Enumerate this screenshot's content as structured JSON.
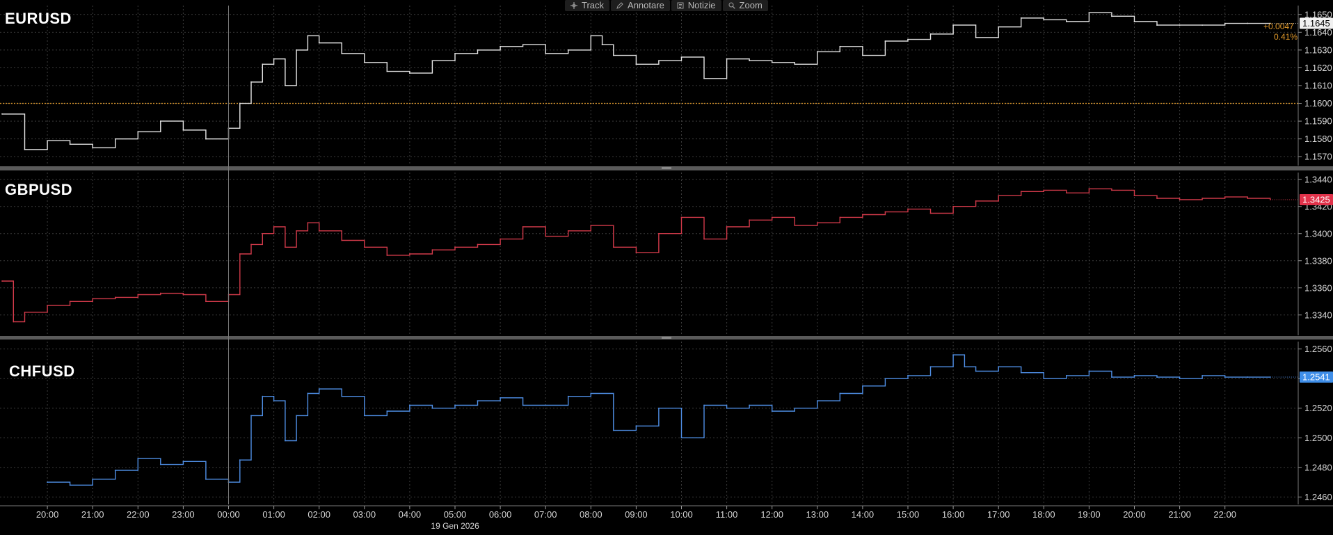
{
  "toolbar": {
    "items": [
      {
        "label": "Track",
        "icon": "crosshair-icon"
      },
      {
        "label": "Annotare",
        "icon": "pencil-icon"
      },
      {
        "label": "Notizie",
        "icon": "news-icon"
      },
      {
        "label": "Zoom",
        "icon": "magnifier-icon"
      }
    ]
  },
  "x_axis": {
    "ticks": [
      "20:00",
      "21:00",
      "22:00",
      "23:00",
      "00:00",
      "01:00",
      "02:00",
      "03:00",
      "04:00",
      "05:00",
      "06:00",
      "07:00",
      "08:00",
      "09:00",
      "10:00",
      "11:00",
      "12:00",
      "13:00",
      "14:00",
      "15:00",
      "16:00",
      "17:00",
      "18:00",
      "19:00",
      "20:00",
      "21:00",
      "22:00"
    ],
    "date_label": "19 Gen 2026"
  },
  "colors": {
    "background": "#000000",
    "grid": "#3c3c3c",
    "eur_line": "#e6e6e6",
    "gbp_line": "#d23a4a",
    "chf_line": "#4f8fe6",
    "reference_line": "#e39b2c",
    "divider": "#5a5a5a"
  },
  "chart_data": [
    {
      "type": "line",
      "title": "EURUSD",
      "last_value": "1.1645",
      "change_abs": "+0.0047",
      "change_pct": "0.41%",
      "reference_level": 1.16,
      "ylim": [
        1.1565,
        1.1655
      ],
      "yticks": [
        "1.1570",
        "1.1580",
        "1.1590",
        "1.1600",
        "1.1610",
        "1.1620",
        "1.1630",
        "1.1640",
        "1.1650"
      ],
      "series": [
        {
          "x": [
            "19:00",
            "19:30",
            "20:00",
            "20:30",
            "21:00",
            "21:30",
            "22:00",
            "22:30",
            "23:00",
            "23:30",
            "00:00",
            "00:15",
            "00:30",
            "00:45",
            "01:00",
            "01:15",
            "01:30",
            "01:45",
            "02:00",
            "02:30",
            "03:00",
            "03:30",
            "04:00",
            "04:30",
            "05:00",
            "05:30",
            "06:00",
            "06:30",
            "07:00",
            "07:30",
            "08:00",
            "08:15",
            "08:30",
            "09:00",
            "09:30",
            "10:00",
            "10:30",
            "11:00",
            "11:30",
            "12:00",
            "12:30",
            "13:00",
            "13:30",
            "14:00",
            "14:30",
            "15:00",
            "15:30",
            "16:00",
            "16:30",
            "17:00",
            "17:30",
            "18:00",
            "18:30",
            "19:00",
            "19:30",
            "20:00",
            "20:30",
            "21:00",
            "21:30",
            "22:00",
            "22:30",
            "23:00"
          ],
          "values": [
            1.1594,
            1.1574,
            1.1579,
            1.1577,
            1.1575,
            1.158,
            1.1584,
            1.159,
            1.1585,
            1.158,
            1.1586,
            1.16,
            1.1612,
            1.1622,
            1.1625,
            1.161,
            1.163,
            1.1638,
            1.1634,
            1.1628,
            1.1623,
            1.1618,
            1.1617,
            1.1624,
            1.1628,
            1.163,
            1.1632,
            1.1633,
            1.1628,
            1.163,
            1.1638,
            1.1633,
            1.1627,
            1.1622,
            1.1624,
            1.1626,
            1.1614,
            1.1625,
            1.1624,
            1.1623,
            1.1622,
            1.1629,
            1.1632,
            1.1627,
            1.1635,
            1.1636,
            1.1639,
            1.1644,
            1.1637,
            1.1643,
            1.1648,
            1.1647,
            1.1646,
            1.1651,
            1.1649,
            1.1646,
            1.1644,
            1.1644,
            1.1644,
            1.1645,
            1.1645,
            1.1645
          ]
        }
      ]
    },
    {
      "type": "line",
      "title": "GBPUSD",
      "last_value": "1.3425",
      "ylim": [
        1.3325,
        1.3445
      ],
      "yticks": [
        "1.3340",
        "1.3360",
        "1.3380",
        "1.3400",
        "1.3420",
        "1.3440"
      ],
      "series": [
        {
          "x": [
            "19:00",
            "19:15",
            "19:30",
            "20:00",
            "20:30",
            "21:00",
            "21:30",
            "22:00",
            "22:30",
            "23:00",
            "23:30",
            "00:00",
            "00:15",
            "00:30",
            "00:45",
            "01:00",
            "01:15",
            "01:30",
            "01:45",
            "02:00",
            "02:30",
            "03:00",
            "03:30",
            "04:00",
            "04:30",
            "05:00",
            "05:30",
            "06:00",
            "06:30",
            "07:00",
            "07:30",
            "08:00",
            "08:30",
            "09:00",
            "09:30",
            "10:00",
            "10:30",
            "11:00",
            "11:30",
            "12:00",
            "12:30",
            "13:00",
            "13:30",
            "14:00",
            "14:30",
            "15:00",
            "15:30",
            "16:00",
            "16:30",
            "17:00",
            "17:30",
            "18:00",
            "18:30",
            "19:00",
            "19:30",
            "20:00",
            "20:30",
            "21:00",
            "21:30",
            "22:00",
            "22:30",
            "23:00"
          ],
          "values": [
            1.3365,
            1.3335,
            1.3342,
            1.3347,
            1.335,
            1.3352,
            1.3353,
            1.3355,
            1.3356,
            1.3355,
            1.335,
            1.3355,
            1.3385,
            1.3392,
            1.34,
            1.3405,
            1.339,
            1.3402,
            1.3408,
            1.3402,
            1.3395,
            1.339,
            1.3384,
            1.3385,
            1.3388,
            1.339,
            1.3392,
            1.3396,
            1.3405,
            1.3398,
            1.3402,
            1.3406,
            1.339,
            1.3386,
            1.34,
            1.3412,
            1.3396,
            1.3405,
            1.341,
            1.3412,
            1.3406,
            1.3408,
            1.3412,
            1.3414,
            1.3416,
            1.3418,
            1.3415,
            1.342,
            1.3424,
            1.3428,
            1.3431,
            1.3432,
            1.343,
            1.3433,
            1.3432,
            1.3428,
            1.3426,
            1.3425,
            1.3426,
            1.3427,
            1.3426,
            1.3425
          ]
        }
      ]
    },
    {
      "type": "line",
      "title": "CHFUSD",
      "last_value": "1.2541",
      "ylim": [
        1.2455,
        1.2565
      ],
      "yticks": [
        "1.2460",
        "1.2480",
        "1.2500",
        "1.2520",
        "1.2540",
        "1.2560"
      ],
      "series": [
        {
          "x": [
            "20:00",
            "20:30",
            "21:00",
            "21:30",
            "22:00",
            "22:30",
            "23:00",
            "23:30",
            "00:00",
            "00:15",
            "00:30",
            "00:45",
            "01:00",
            "01:15",
            "01:30",
            "01:45",
            "02:00",
            "02:30",
            "03:00",
            "03:30",
            "04:00",
            "04:30",
            "05:00",
            "05:30",
            "06:00",
            "06:30",
            "07:00",
            "07:30",
            "08:00",
            "08:30",
            "09:00",
            "09:30",
            "10:00",
            "10:30",
            "11:00",
            "11:30",
            "12:00",
            "12:30",
            "13:00",
            "13:30",
            "14:00",
            "14:30",
            "15:00",
            "15:30",
            "16:00",
            "16:15",
            "16:30",
            "17:00",
            "17:30",
            "18:00",
            "18:30",
            "19:00",
            "19:30",
            "20:00",
            "20:30",
            "21:00",
            "21:30",
            "22:00",
            "22:30",
            "23:00"
          ],
          "values": [
            1.247,
            1.2468,
            1.2472,
            1.2478,
            1.2486,
            1.2482,
            1.2484,
            1.2472,
            1.247,
            1.2485,
            1.2515,
            1.2528,
            1.2525,
            1.2498,
            1.2515,
            1.253,
            1.2533,
            1.2528,
            1.2515,
            1.2518,
            1.2522,
            1.252,
            1.2522,
            1.2525,
            1.2527,
            1.2522,
            1.2522,
            1.2528,
            1.253,
            1.2505,
            1.2508,
            1.252,
            1.25,
            1.2522,
            1.252,
            1.2522,
            1.2518,
            1.252,
            1.2525,
            1.253,
            1.2535,
            1.254,
            1.2542,
            1.2548,
            1.2556,
            1.2548,
            1.2545,
            1.2548,
            1.2544,
            1.254,
            1.2542,
            1.2545,
            1.2541,
            1.2542,
            1.2541,
            1.254,
            1.2542,
            1.2541,
            1.2541,
            1.2541
          ]
        }
      ]
    }
  ]
}
